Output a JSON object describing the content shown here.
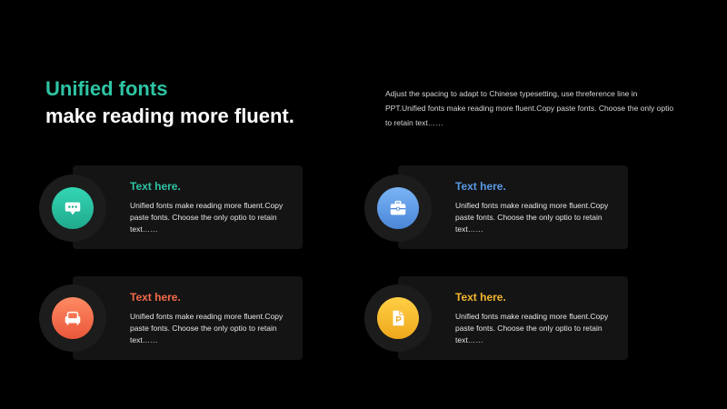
{
  "header": {
    "title_line1": "Unified fonts",
    "title_line2": "make reading more fluent.",
    "intro_text": "Adjust the spacing to adapt to Chinese typesetting, use threference line in PPT.Unified fonts make reading more fluent.Copy paste fonts. Choose the only optio to retain text……"
  },
  "colors": {
    "accent_green": "#2ec4a4",
    "accent_blue": "#5a9ae6",
    "accent_orange": "#f26b4a",
    "accent_yellow": "#f2b630"
  },
  "cards": [
    {
      "heading": "Text here.",
      "body": "Unified fonts make reading more fluent.Copy paste fonts. Choose the only optio to retain text……",
      "icon": "chat-bubble-icon"
    },
    {
      "heading": "Text here.",
      "body": "Unified fonts make reading more fluent.Copy paste fonts. Choose the only optio to retain text……",
      "icon": "briefcase-icon"
    },
    {
      "heading": "Text here.",
      "body": "Unified fonts make reading more fluent.Copy paste fonts. Choose the only optio to retain text……",
      "icon": "sofa-icon"
    },
    {
      "heading": "Text here.",
      "body": "Unified fonts make reading more fluent.Copy paste fonts. Choose the only optio to retain text……",
      "icon": "document-icon"
    }
  ]
}
